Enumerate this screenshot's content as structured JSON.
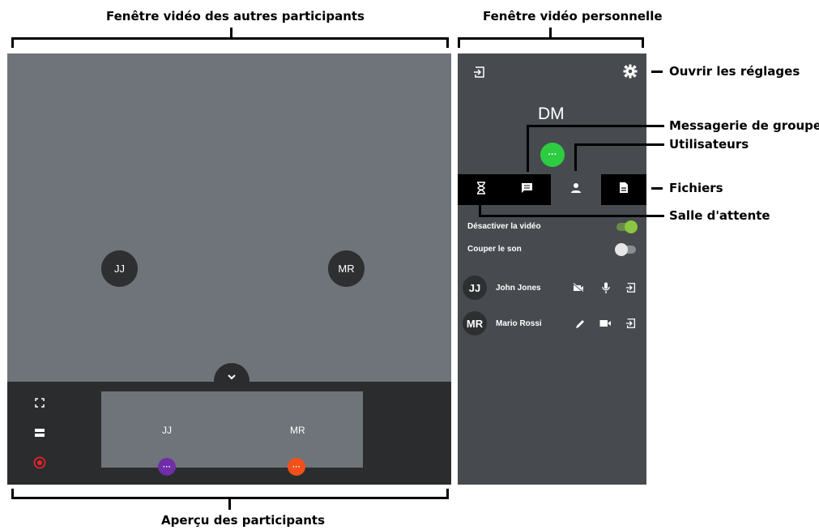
{
  "annotations": {
    "others_video": "Fenêtre vidéo des autres participants",
    "self_video": "Fenêtre vidéo personnelle",
    "preview": "Aperçu des participants",
    "settings": "Ouvrir les réglages",
    "group_chat": "Messagerie de groupe",
    "users": "Utilisateurs",
    "files": "Fichiers",
    "waiting_room": "Salle d'attente"
  },
  "main_video": {
    "participants": [
      {
        "initials": "JJ"
      },
      {
        "initials": "MR"
      }
    ]
  },
  "preview": {
    "tiles": [
      {
        "label": "JJ",
        "dot_color": "#6f2da8"
      },
      {
        "label": "MR",
        "dot_color": "#f2501a"
      }
    ],
    "dots": "···"
  },
  "side_panel": {
    "self_initials": "DM",
    "status_dots": "···",
    "status_color": "#2ecc40",
    "toggles": [
      {
        "label": "Désactiver la vidéo",
        "on": true
      },
      {
        "label": "Couper le son",
        "on": false
      }
    ],
    "users": [
      {
        "initials": "JJ",
        "name": "John Jones",
        "icons": [
          "video-off-icon",
          "microphone-icon",
          "exit-icon"
        ]
      },
      {
        "initials": "MR",
        "name": "Mario Rossi",
        "icons": [
          "pencil-icon",
          "camera-icon",
          "exit-icon"
        ]
      }
    ]
  },
  "colors": {
    "video_bg": "#6e7479",
    "panel_bg": "#474b4f",
    "bar_bg": "#2b2c2e",
    "record_red": "#e8222a"
  }
}
